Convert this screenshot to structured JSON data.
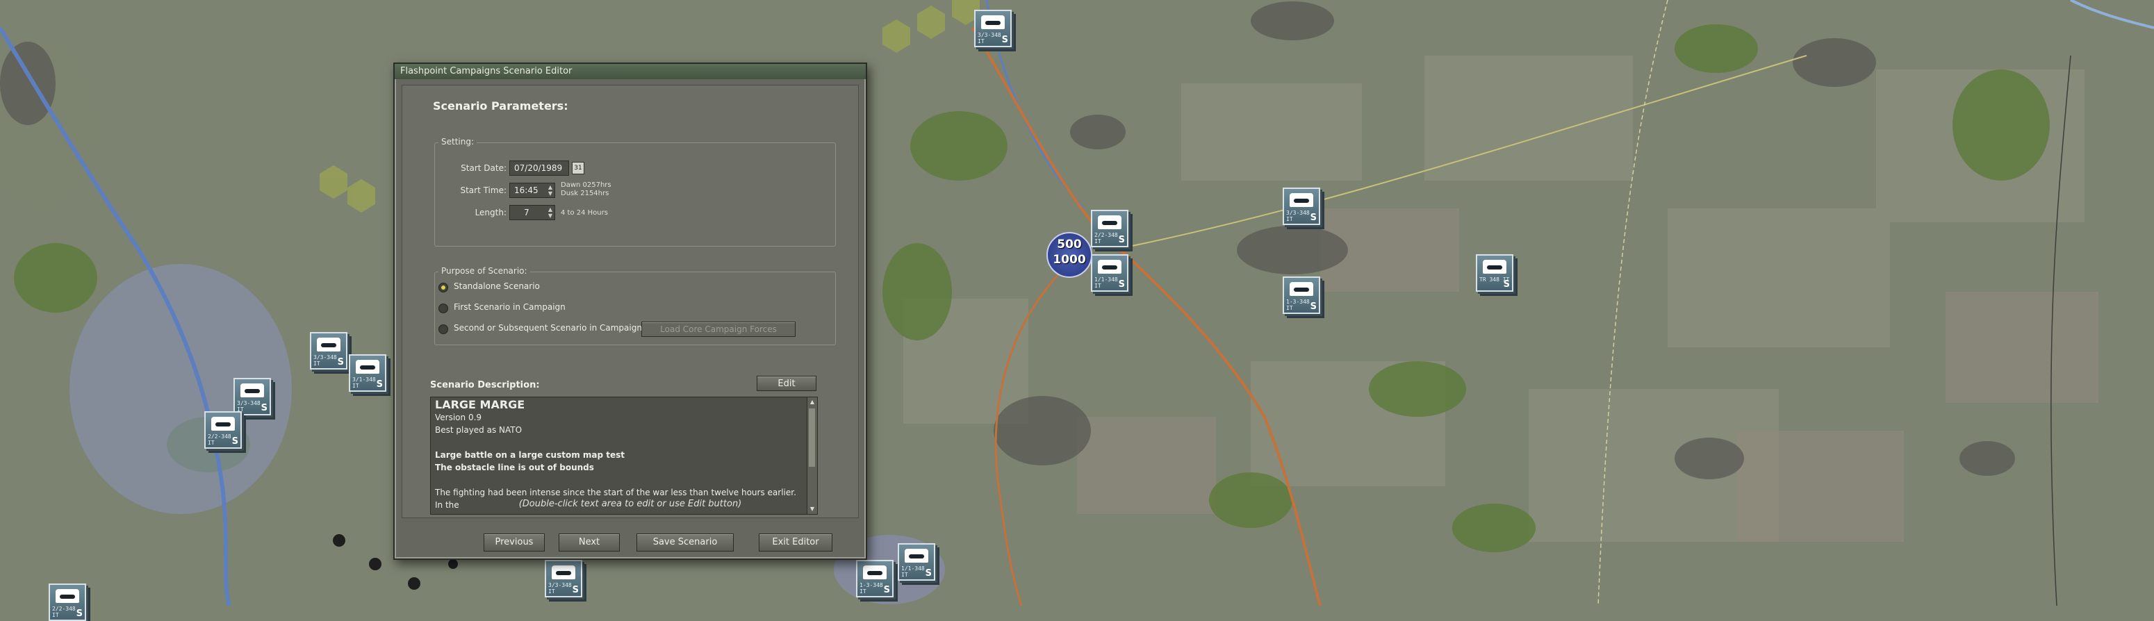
{
  "window": {
    "title": "Flashpoint Campaigns Scenario Editor"
  },
  "heading": "Scenario Parameters:",
  "setting": {
    "legend": "Setting:",
    "start_date_label": "Start Date:",
    "start_date": "07/20/1989",
    "start_time_label": "Start Time:",
    "start_time": "16:45",
    "dawn": "Dawn 0257hrs",
    "dusk": "Dusk 2154hrs",
    "length_label": "Length:",
    "length": "7",
    "length_hint": "4 to 24 Hours"
  },
  "purpose": {
    "legend": "Purpose of Scenario:",
    "options": [
      {
        "label": "Standalone Scenario",
        "selected": true
      },
      {
        "label": "First Scenario in Campaign",
        "selected": false
      },
      {
        "label": "Second or Subsequent Scenario in Campaign",
        "selected": false
      }
    ],
    "load_forces_label": "Load Core Campaign Forces"
  },
  "description": {
    "label": "Scenario Description:",
    "edit_label": "Edit",
    "title": "LARGE MARGE",
    "version": "Version 0.9",
    "played_as": "Best played as NATO",
    "bold1": "Large battle on a large custom map test",
    "bold2": "The obstacle line is out of bounds",
    "body": "The fighting had been intense since the start of the war less than twelve hours earlier. In the",
    "hint": "(Double-click text area to edit or use Edit button)"
  },
  "buttons": {
    "previous": "Previous",
    "next": "Next",
    "save": "Save Scenario",
    "exit": "Exit Editor"
  },
  "map": {
    "marker_top": "500",
    "marker_bottom": "1000",
    "unit_tag": "S",
    "unit_ids": [
      "3/3-348 IT",
      "3/3-348 IT",
      "2/2-348 IT",
      "1/1-348 IT",
      "1-3-348 IT",
      "TR 348 IT",
      "3/3-348 IT",
      "3/1-348 IT",
      "3/3-348 IT",
      "2/2-348 IT",
      "3/3-348 IT",
      "1/1-348 IT",
      "1-3-348 IT",
      "2/2-348 IT",
      "3/3-348 IT"
    ]
  },
  "colors": {
    "terrain": "#7c8371",
    "dialog": "#66685f",
    "titlebar": "#4b5c46",
    "radio_selected": "#e8cc44",
    "unit": "#5f7c89"
  }
}
